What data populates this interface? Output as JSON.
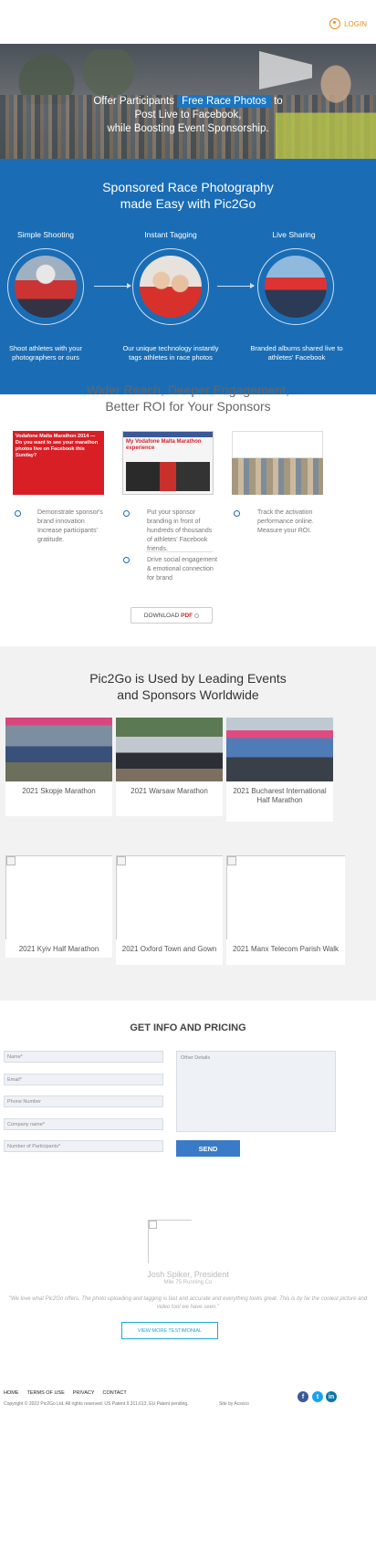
{
  "header": {
    "login_label": "LOGIN"
  },
  "hero": {
    "line1_before": "Offer Participants",
    "highlight": "Free Race Photos",
    "line1_after": "to",
    "line2": "Post Live to Facebook,",
    "line3": "while Boosting Event Sponsorship."
  },
  "sponsored": {
    "title_line1": "Sponsored Race Photography",
    "title_line2": "made Easy with Pic2Go",
    "steps": [
      {
        "title": "Simple Shooting",
        "desc": "Shoot athletes with your photographers or ours"
      },
      {
        "title": "Instant Tagging",
        "desc": "Our unique technology instantly tags athletes in race photos"
      },
      {
        "title": "Live Sharing",
        "desc": "Branded albums shared live to athletes' Facebook"
      }
    ]
  },
  "reach": {
    "title_line1": "Wider Reach, Deeper Engagement,",
    "title_line2": "Better ROI for Your Sponsors",
    "thumb1_text": "Vodafone Malta Marathon 2014 — Do you want to see your marathon photos live on Facebook this Sunday?",
    "thumb2_text": "My Vodafone Malta Marathon experience",
    "bullets": [
      "Demonstrate sponsor's brand innovation Increase participants' gratitude.",
      "Put your sponsor branding in front of hundreds of thousands of athletes' Facebook friends.",
      "Drive social engagement & emotional connection for brand",
      "Track the activation performance online. Measure your ROI."
    ],
    "download_label": "DOWNLOAD",
    "download_pdf": "PDF"
  },
  "events": {
    "title_line1": "Pic2Go is Used by Leading Events",
    "title_line2": "and Sponsors Worldwide",
    "items": [
      "2021 Skopje Marathon",
      "2021 Warsaw Marathon",
      "2021 Bucharest International Half Marathon",
      "2021 Kyiv Half Marathon",
      "2021 Oxford Town and Gown",
      "2021 Manx Telecom Parish Walk"
    ]
  },
  "form": {
    "title": "GET INFO AND PRICING",
    "name_placeholder": "Name*",
    "email_placeholder": "Email*",
    "phone_placeholder": "Phone Number",
    "company_placeholder": "Company name*",
    "participants_placeholder": "Number of Participants*",
    "details_placeholder": "Other Details",
    "send_label": "SEND"
  },
  "testimonial": {
    "name": "Josh Spiker, President",
    "club": "Mile 75 Running Co",
    "quote": "\"We love what Pic2Go offers. The photo uploading and tagging is fast and accurate and everything looks great. This is by far the coolest picture and video tool we have seen.\"",
    "more_label": "VIEW MORE TESTIMONIAL"
  },
  "footer": {
    "nav": [
      "HOME",
      "TERMS OF USE",
      "PRIVACY",
      "CONTACT"
    ],
    "copyright": "Copyright © 2022 Pic2Go Ltd. All rights reserved. US Patent 9,311,613. EU Patent pending.",
    "site_by": "Site by Acsoco",
    "social": [
      "facebook-icon",
      "twitter-icon",
      "linkedin-icon"
    ],
    "colors": {
      "facebook": "#3b5998",
      "twitter": "#1da1f2",
      "linkedin": "#0e76a8"
    }
  },
  "colors": {
    "brand_blue": "#1a6db5",
    "accent_orange": "#f08c1e",
    "pdf_red": "#d81f26"
  }
}
